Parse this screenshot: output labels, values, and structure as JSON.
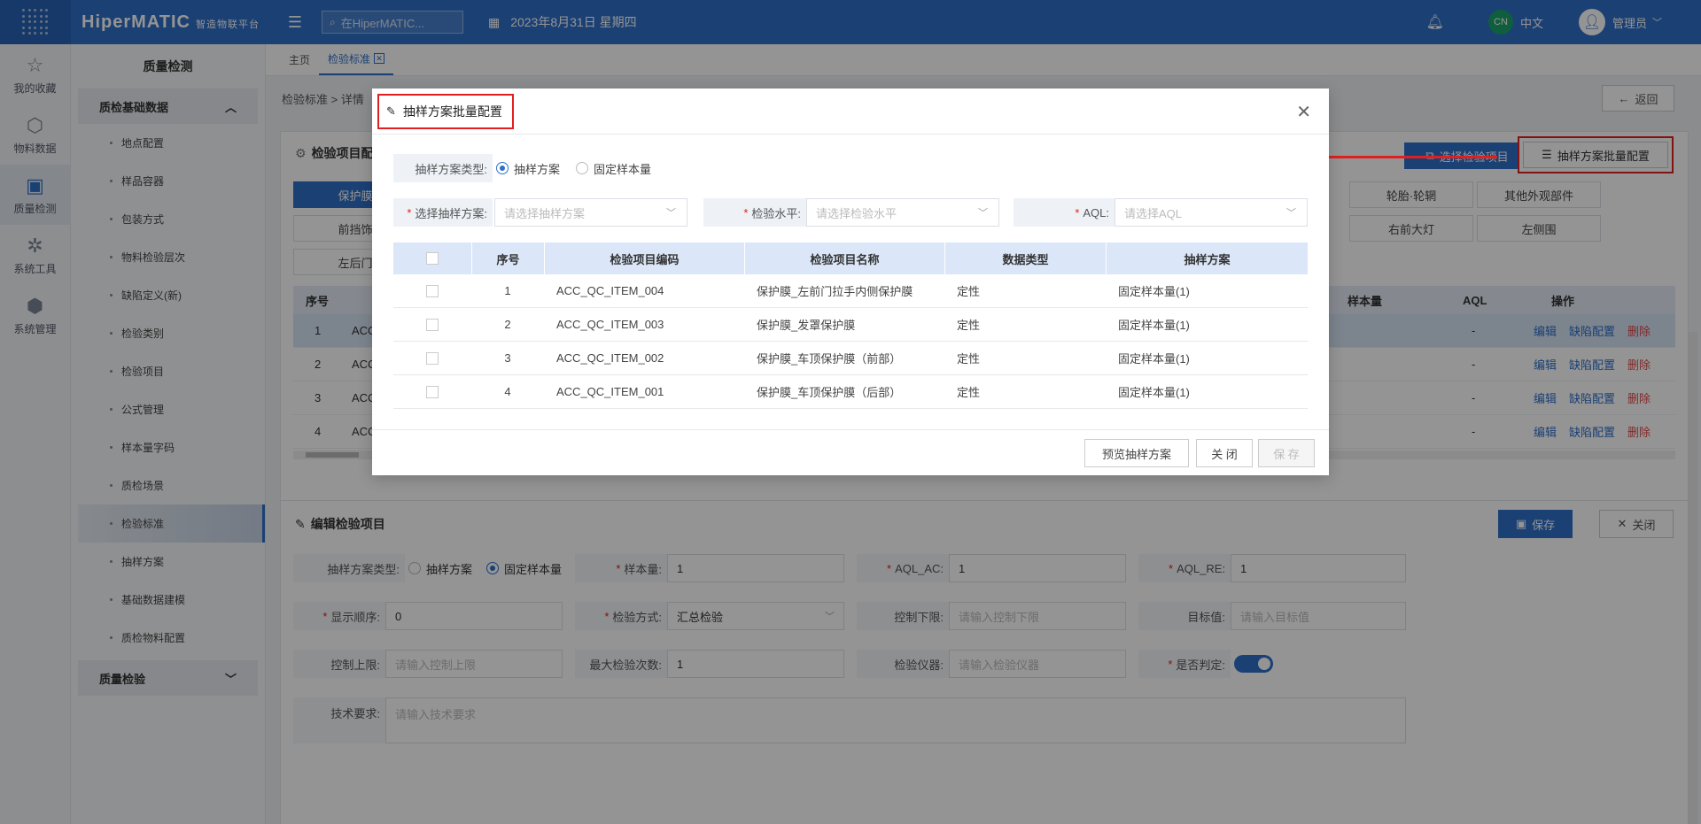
{
  "topbar": {
    "brand": "HiperMATIC",
    "brand_sub": "智造物联平台",
    "search_placeholder": "在HiperMATIC...",
    "date": "2023年8月31日 星期四",
    "lang_badge": "CN",
    "lang_label": "中文",
    "user": "管理员"
  },
  "rail": [
    {
      "label": "我的收藏",
      "icon": "star-icon"
    },
    {
      "label": "物料数据",
      "icon": "cube-icon"
    },
    {
      "label": "质量检测",
      "icon": "quality-icon"
    },
    {
      "label": "系统工具",
      "icon": "network-icon"
    },
    {
      "label": "系统管理",
      "icon": "settings-cube-icon"
    }
  ],
  "sidebar": {
    "title": "质量检测",
    "group1": "质检基础数据",
    "items": [
      "地点配置",
      "样品容器",
      "包装方式",
      "物料检验层次",
      "缺陷定义(新)",
      "检验类别",
      "检验项目",
      "公式管理",
      "样本量字码",
      "质检场景",
      "检验标准",
      "抽样方案",
      "基础数据建模",
      "质检物料配置"
    ],
    "group2": "质量检验"
  },
  "tabs": {
    "home": "主页",
    "current": "检验标准"
  },
  "breadcrumb": {
    "a": "检验标准",
    "sep": ">",
    "b": "详情"
  },
  "back_label": "返回",
  "top_panel": {
    "title": "检验项目配置",
    "select_btn": "选择检验项目",
    "batch_btn": "抽样方案批量配置",
    "chips_row1": [
      "保护膜",
      "轮胎·轮辋",
      "其他外观部件"
    ],
    "chips_row2": [
      "前挡饰",
      "右前大灯",
      "左侧围"
    ],
    "chips_row3": [
      "左后门"
    ],
    "grid_headers": {
      "seq": "序号",
      "sample": "样本量",
      "aql": "AQL",
      "op": "操作"
    },
    "rows": [
      {
        "seq": "1",
        "code": "ACC",
        "aql": "-"
      },
      {
        "seq": "2",
        "code": "ACC",
        "aql": "-"
      },
      {
        "seq": "3",
        "code": "ACC",
        "aql": "-"
      },
      {
        "seq": "4",
        "code": "ACC",
        "aql": "-"
      }
    ],
    "op_edit": "编辑",
    "op_defect": "缺陷配置",
    "op_delete": "删除"
  },
  "bottom_panel": {
    "title": "编辑检验项目",
    "save": "保存",
    "close": "关闭",
    "sampling_type_label": "抽样方案类型:",
    "opt_plan": "抽样方案",
    "opt_fixed": "固定样本量",
    "sample_size_label": "样本量:",
    "sample_size": "1",
    "aql_ac_label": "AQL_AC:",
    "aql_ac": "1",
    "aql_re_label": "AQL_RE:",
    "aql_re": "1",
    "order_label": "显示顺序:",
    "order": "0",
    "method_label": "检验方式:",
    "method": "汇总检验",
    "lower_label": "控制下限:",
    "lower_ph": "请输入控制下限",
    "target_label": "目标值:",
    "target_ph": "请输入目标值",
    "upper_label": "控制上限:",
    "upper_ph": "请输入控制上限",
    "max_label": "最大检验次数:",
    "max": "1",
    "instrument_label": "检验仪器:",
    "instrument_ph": "请输入检验仪器",
    "judge_label": "是否判定:",
    "tech_label": "技术要求:",
    "tech_ph": "请输入技术要求"
  },
  "modal": {
    "title": "抽样方案批量配置",
    "type_label": "抽样方案类型:",
    "opt_plan": "抽样方案",
    "opt_fixed": "固定样本量",
    "plan_label": "选择抽样方案:",
    "plan_ph": "请选择抽样方案",
    "level_label": "检验水平:",
    "level_ph": "请选择检验水平",
    "aql_label": "AQL:",
    "aql_ph": "请选择AQL",
    "headers": {
      "seq": "序号",
      "code": "检验项目编码",
      "name": "检验项目名称",
      "dtype": "数据类型",
      "plan": "抽样方案"
    },
    "rows": [
      {
        "seq": "1",
        "code": "ACC_QC_ITEM_004",
        "name": "保护膜_左前门拉手内侧保护膜",
        "dtype": "定性",
        "plan": "固定样本量(1)"
      },
      {
        "seq": "2",
        "code": "ACC_QC_ITEM_003",
        "name": "保护膜_发罩保护膜",
        "dtype": "定性",
        "plan": "固定样本量(1)"
      },
      {
        "seq": "3",
        "code": "ACC_QC_ITEM_002",
        "name": "保护膜_车顶保护膜（前部）",
        "dtype": "定性",
        "plan": "固定样本量(1)"
      },
      {
        "seq": "4",
        "code": "ACC_QC_ITEM_001",
        "name": "保护膜_车顶保护膜（后部）",
        "dtype": "定性",
        "plan": "固定样本量(1)"
      }
    ],
    "btn_preview": "预览抽样方案",
    "btn_close": "关 闭",
    "btn_save": "保 存"
  }
}
